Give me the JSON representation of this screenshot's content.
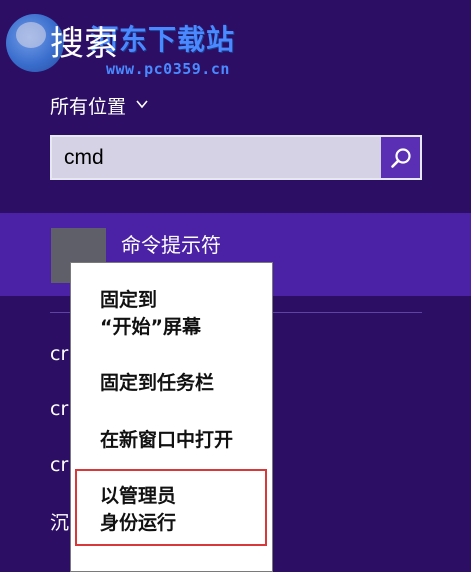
{
  "watermark": {
    "title": "河东下载站",
    "url": "www.pc0359.cn"
  },
  "header": {
    "title": "搜索",
    "scope_label": "所有位置"
  },
  "search": {
    "value": "cmd"
  },
  "results": {
    "selected_label": "命令提示符",
    "items": [
      "cr",
      "cr",
      "cr",
      "沉"
    ]
  },
  "context_menu": {
    "pin_start_line1": "固定到",
    "pin_start_line2": "“开始”屏幕",
    "pin_taskbar": "固定到任务栏",
    "open_new_window": "在新窗口中打开",
    "run_admin_line1": "以管理员",
    "run_admin_line2": "身份运行"
  },
  "colors": {
    "background": "#2c0e64",
    "selected_row": "#4b21a6",
    "search_button": "#5a2fb3",
    "highlight_border": "#d9383a"
  }
}
